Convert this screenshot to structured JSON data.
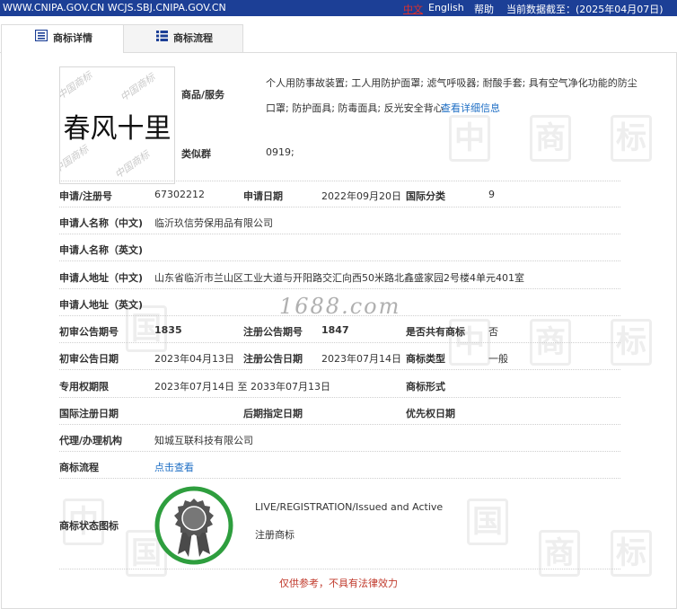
{
  "topbar": {
    "sites": "WWW.CNIPA.GOV.CN  WCJS.SBJ.CNIPA.GOV.CN",
    "lang_cn": "中文",
    "lang_en": "English",
    "help": "帮助",
    "data_date": "当前数据截至：(2025年04月07日)"
  },
  "tabs": [
    {
      "label": "商标详情",
      "active": true
    },
    {
      "label": "商标流程",
      "active": false
    }
  ],
  "logo": {
    "text": "春风十里",
    "background_text": "中国商标"
  },
  "watermark": {
    "chars": [
      "中",
      "国",
      "商",
      "标"
    ],
    "site_text": "1688.com"
  },
  "goods": {
    "label": "商品/服务",
    "value_line1": "个人用防事故装置; 工人用防护面罩; 滤气呼吸器; 耐酸手套; 具有空气净化功能的防尘",
    "value_line2": "口罩; 防护面具; 防毒面具; 反光安全背心",
    "detail_link": "查看详细信息"
  },
  "similar_group": {
    "label": "类似群",
    "value": "0919;"
  },
  "reg_no": {
    "label": "申请/注册号",
    "value": "67302212"
  },
  "app_date": {
    "label": "申请日期",
    "value": "2022年09月20日"
  },
  "intl_class": {
    "label": "国际分类",
    "value": "9"
  },
  "applicant_cn": {
    "label": "申请人名称（中文)",
    "value": "临沂玖信劳保用品有限公司"
  },
  "applicant_en": {
    "label": "申请人名称（英文)",
    "value": ""
  },
  "address_cn": {
    "label": "申请人地址（中文)",
    "value": "山东省临沂市兰山区工业大道与开阳路交汇向西50米路北鑫盛家园2号楼4单元401室"
  },
  "address_en": {
    "label": "申请人地址（英文)",
    "value": ""
  },
  "prelim_no": {
    "label": "初审公告期号",
    "value": "1835"
  },
  "reg_ann_no": {
    "label": "注册公告期号",
    "value": "1847"
  },
  "shared": {
    "label": "是否共有商标",
    "value": "否"
  },
  "prelim_date": {
    "label": "初审公告日期",
    "value": "2023年04月13日"
  },
  "reg_ann_date": {
    "label": "注册公告日期",
    "value": "2023年07月14日"
  },
  "tm_type": {
    "label": "商标类型",
    "value": "一般"
  },
  "exclusive_period": {
    "label": "专用权期限",
    "value": "2023年07月14日 至 2033年07月13日"
  },
  "tm_form": {
    "label": "商标形式",
    "value": ""
  },
  "intl_reg_date": {
    "label": "国际注册日期",
    "value": ""
  },
  "later_date": {
    "label": "后期指定日期",
    "value": ""
  },
  "priority_date": {
    "label": "优先权日期",
    "value": ""
  },
  "agent": {
    "label": "代理/办理机构",
    "value": "知城互联科技有限公司"
  },
  "flow": {
    "label": "商标流程",
    "link": "点击查看"
  },
  "status": {
    "label": "商标状态图标",
    "en": "LIVE/REGISTRATION/Issued and Active",
    "cn": "注册商标",
    "ring_color": "#2e9e3e"
  },
  "footer": "仅供参考，不具有法律效力"
}
